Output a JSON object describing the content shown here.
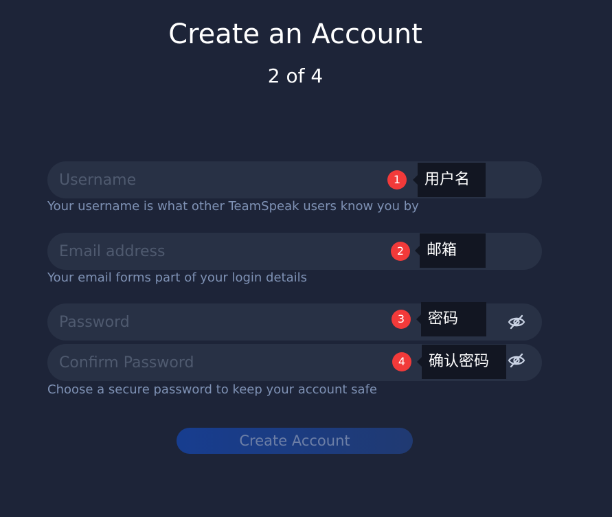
{
  "header": {
    "title": "Create an Account",
    "step": "2 of 4"
  },
  "form": {
    "username": {
      "placeholder": "Username",
      "value": "",
      "helper": "Your username is what other TeamSpeak users know you by",
      "annotation_number": "1",
      "annotation_label": "用户名"
    },
    "email": {
      "placeholder": "Email address",
      "value": "",
      "helper": "Your email forms part of your login details",
      "annotation_number": "2",
      "annotation_label": "邮箱"
    },
    "password": {
      "placeholder": "Password",
      "value": "",
      "annotation_number": "3",
      "annotation_label": "密码",
      "toggle_icon": "eye-slash-icon"
    },
    "confirm_password": {
      "placeholder": "Confirm Password",
      "value": "",
      "helper": "Choose a secure password to keep your account safe",
      "annotation_number": "4",
      "annotation_label": "确认密码",
      "toggle_icon": "eye-slash-icon"
    }
  },
  "actions": {
    "create_label": "Create Account"
  },
  "colors": {
    "background": "#1d2438",
    "field": "#283145",
    "helper_text": "#7f92b5",
    "annotation_badge": "#f23a3a",
    "annotation_label_bg": "#121622",
    "button": "#1b3c84"
  }
}
